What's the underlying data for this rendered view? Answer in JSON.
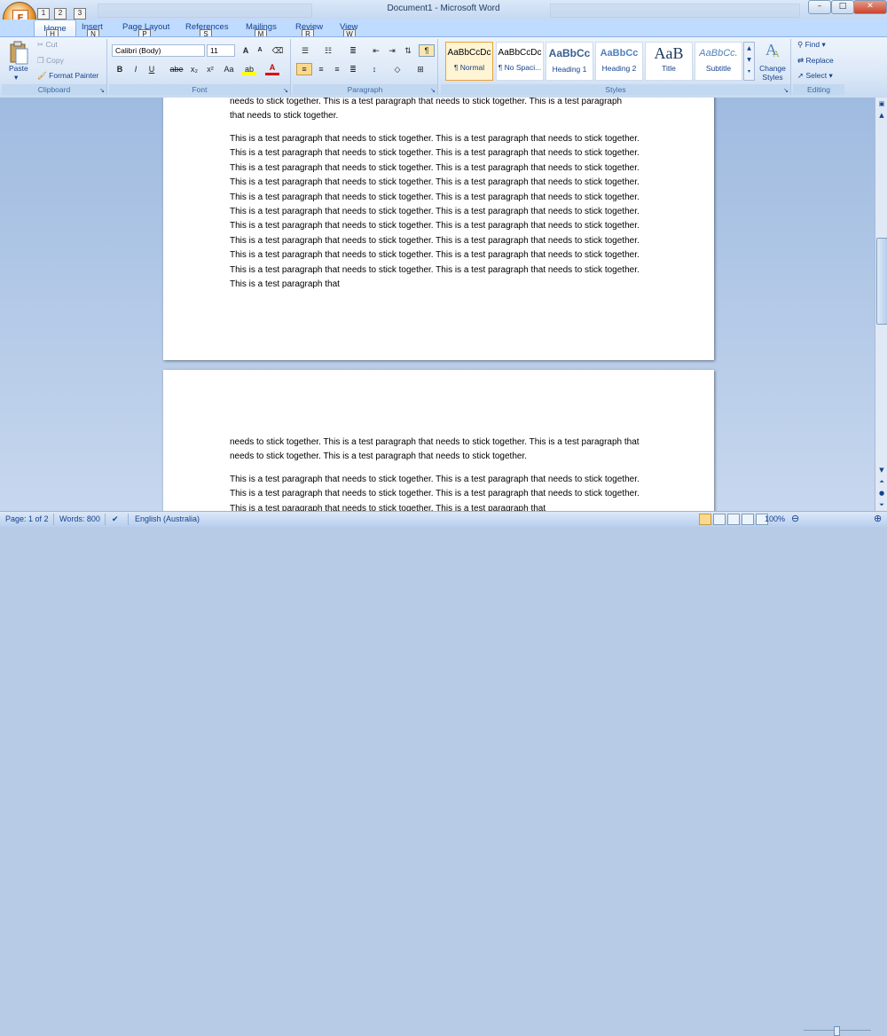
{
  "window": {
    "title": "Document1 - Microsoft Word",
    "controls": {
      "minimize": "–",
      "maximize": "□",
      "close": "✕"
    }
  },
  "office_button": {
    "keytip": "F"
  },
  "quick_access": [
    {
      "icon": "save-icon",
      "keytip": "1"
    },
    {
      "icon": "undo-icon",
      "keytip": "2"
    },
    {
      "icon": "redo-icon",
      "keytip": "3"
    }
  ],
  "tabs": [
    {
      "label": "Home",
      "keytip": "H",
      "active": true
    },
    {
      "label": "Insert",
      "keytip": "N"
    },
    {
      "label": "Page Layout",
      "keytip": "P"
    },
    {
      "label": "References",
      "keytip": "S"
    },
    {
      "label": "Mailings",
      "keytip": "M"
    },
    {
      "label": "Review",
      "keytip": "R"
    },
    {
      "label": "View",
      "keytip": "W"
    }
  ],
  "clipboard": {
    "label": "Clipboard",
    "paste": "Paste",
    "cut": "Cut",
    "copy": "Copy",
    "format_painter": "Format Painter"
  },
  "font": {
    "label": "Font",
    "font_name": "Calibri (Body)",
    "font_size": "11",
    "grow": "A",
    "shrink": "A",
    "bold": "B",
    "italic": "I",
    "underline": "U",
    "strikethrough": "abe",
    "subscript": "x₂",
    "superscript": "x²",
    "change_case": "Aa",
    "highlight": "ab",
    "font_color": "A"
  },
  "paragraph": {
    "label": "Paragraph",
    "show_marks": "¶"
  },
  "styles": {
    "label": "Styles",
    "items": [
      {
        "sample": "AaBbCcDc",
        "name": "¶ Normal"
      },
      {
        "sample": "AaBbCcDc",
        "name": "¶ No Spaci..."
      },
      {
        "sample": "AaBbCc",
        "name": "Heading 1"
      },
      {
        "sample": "AaBbCc",
        "name": "Heading 2"
      },
      {
        "sample": "AaB",
        "name": "Title"
      },
      {
        "sample": "AaBbCc.",
        "name": "Subtitle"
      }
    ],
    "change_styles": "Change Styles"
  },
  "editing": {
    "label": "Editing",
    "find": "Find",
    "replace": "Replace",
    "select": "Select"
  },
  "document": {
    "page1_top_line1": "needs to stick together. This is  a test paragraph that needs to stick together. This is  a test paragraph",
    "page1_top_line2": "that needs to stick together.",
    "page1_para": "This is  a test paragraph that needs to stick together. This is  a test paragraph that needs to stick together. This is a test paragraph that needs to stick together. This is a test paragraph that needs to stick together. This is  a test paragraph that needs to stick together. This is  a test paragraph that needs to stick together. This is  a test paragraph that needs to stick together. This is  a test paragraph that needs to stick together.   This is  a test paragraph that needs to stick together. This is  a test paragraph that needs to stick together. This is  a test paragraph that needs to stick together. This is a test paragraph that needs to stick together. This is  a test paragraph that needs to stick together. This is  a test paragraph that needs to stick together. This is  a test paragraph that needs to stick together. This is  a test paragraph that needs to stick together. This is  a test paragraph that needs to stick together. This is  a test paragraph that needs to stick together. This is  a test paragraph that needs to stick together. This is  a test paragraph that needs to stick together. This is  a test paragraph that",
    "page2_para1": "needs to stick together. This is  a test paragraph that needs to stick together. This is  a test paragraph that needs to stick together. This is  a test paragraph that needs to stick together.",
    "page2_para2": "This is  a test paragraph that needs to stick together. This is  a test paragraph that needs to stick together. This is a test paragraph that needs to stick together. This is a test paragraph that needs to stick together. This is  a test paragraph that needs to stick together. This is  a test paragraph that"
  },
  "statusbar": {
    "page": "Page: 1 of 2",
    "words": "Words: 800",
    "language": "English (Australia)",
    "zoom": "100%"
  }
}
